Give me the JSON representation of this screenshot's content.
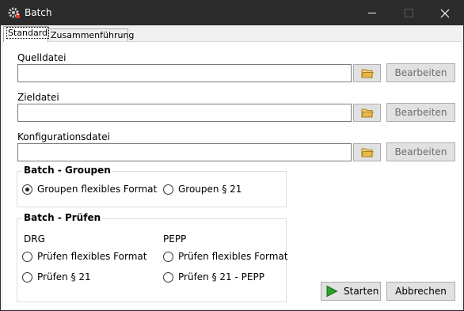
{
  "window": {
    "title": "Batch",
    "icon": "gear-app-icon"
  },
  "titlebar": {
    "minimize_icon": "minimize-icon",
    "maximize_icon": "maximize-icon",
    "close_icon": "close-icon"
  },
  "tabs": [
    {
      "label": "Standard",
      "selected": true
    },
    {
      "label": "Zusammenführung",
      "selected": false
    }
  ],
  "files": [
    {
      "label": "Quelldatei",
      "value": "",
      "browse_icon": "folder-icon",
      "edit_label": "Bearbeiten"
    },
    {
      "label": "Zieldatei",
      "value": "",
      "browse_icon": "folder-icon",
      "edit_label": "Bearbeiten"
    },
    {
      "label": "Konfigurationsdatei",
      "value": "",
      "browse_icon": "folder-icon",
      "edit_label": "Bearbeiten"
    }
  ],
  "batch_groupen": {
    "title": "Batch - Groupen",
    "options": [
      {
        "label": "Groupen flexibles Format",
        "checked": true
      },
      {
        "label": "Groupen § 21",
        "checked": false
      }
    ]
  },
  "batch_pruefen": {
    "title": "Batch - Prüfen",
    "drg": {
      "heading": "DRG",
      "options": [
        {
          "label": "Prüfen flexibles Format",
          "checked": false
        },
        {
          "label": "Prüfen § 21",
          "checked": false
        }
      ]
    },
    "pepp": {
      "heading": "PEPP",
      "options": [
        {
          "label": "Prüfen flexibles Format",
          "checked": false
        },
        {
          "label": "Prüfen § 21 - PEPP",
          "checked": false
        }
      ]
    }
  },
  "actions": {
    "start_label": "Starten",
    "start_icon": "play-icon",
    "cancel_label": "Abbrechen"
  },
  "colors": {
    "titlebar": "#2b2b2b",
    "start_icon": "#2ca02c",
    "folder_icon": "#e8b84a"
  }
}
